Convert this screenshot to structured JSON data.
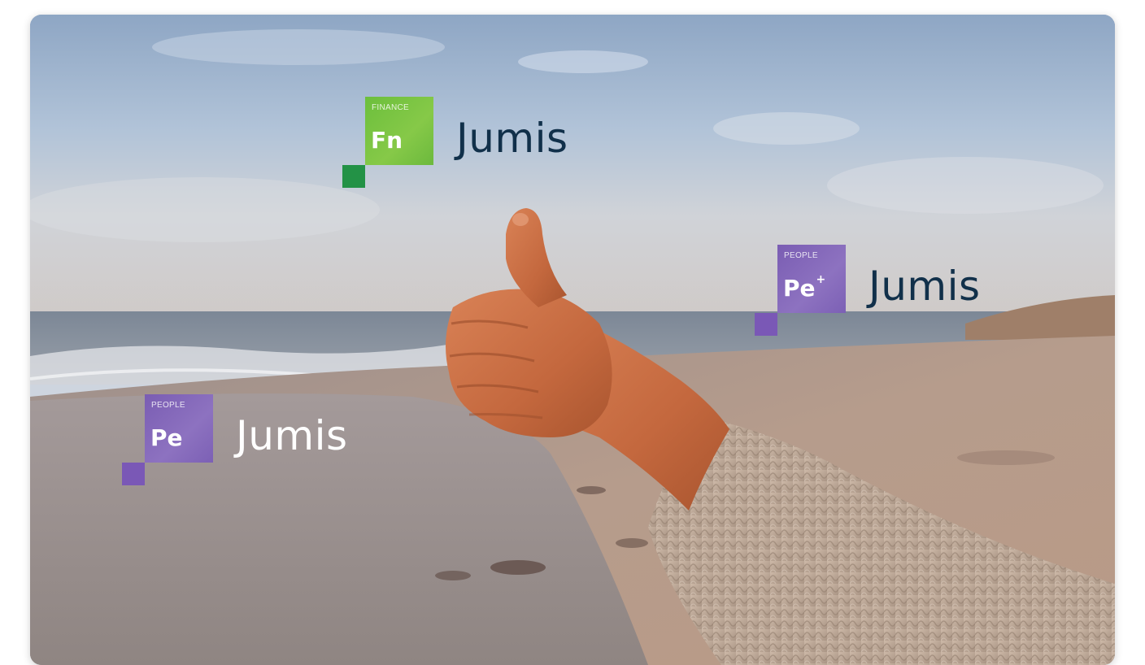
{
  "badges": [
    {
      "category": "FINANCE",
      "symbol": "Fn",
      "superscript": "",
      "brand": "Jumis",
      "tile_color": "#7cc245",
      "corner_color": "#239246",
      "brand_color": "#11304a"
    },
    {
      "category": "PEOPLE",
      "symbol": "Pe",
      "superscript": "+",
      "brand": "Jumis",
      "tile_color": "#8a6dbf",
      "corner_color": "#7a58b6",
      "brand_color": "#11304a"
    },
    {
      "category": "PEOPLE",
      "symbol": "Pe",
      "superscript": "",
      "brand": "Jumis",
      "tile_color": "#8a6dbf",
      "corner_color": "#7a58b6",
      "brand_color": "#ffffff"
    }
  ]
}
